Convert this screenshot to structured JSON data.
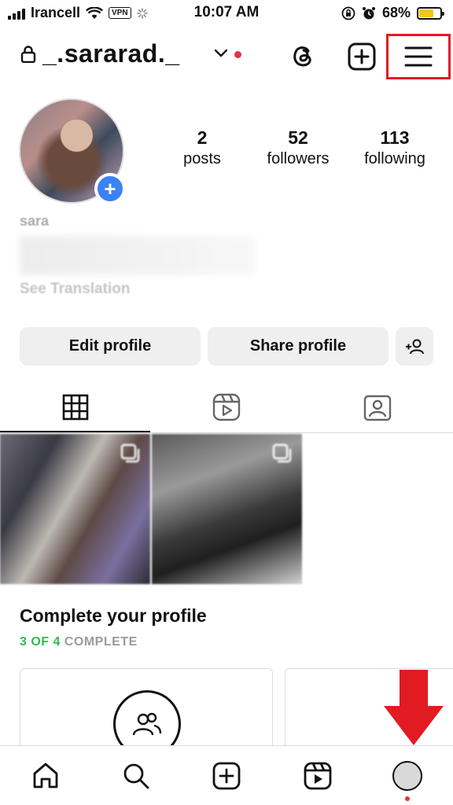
{
  "status_bar": {
    "carrier": "Irancell",
    "vpn": "VPN",
    "time": "10:07 AM",
    "battery": "68%",
    "battery_level": 0.68,
    "battery_color": "#f5c518"
  },
  "header": {
    "username": "_.sararad._",
    "icons": [
      "lock-icon",
      "chevron-down-icon",
      "threads-icon",
      "create-icon",
      "menu-icon"
    ]
  },
  "profile": {
    "stats": [
      {
        "value": "2",
        "label": "posts"
      },
      {
        "value": "52",
        "label": "followers"
      },
      {
        "value": "113",
        "label": "following"
      }
    ],
    "name": "sara",
    "see_translation": "See Translation",
    "add_story": "+"
  },
  "buttons": {
    "edit": "Edit profile",
    "share": "Share profile"
  },
  "tabs": [
    "grid-icon",
    "reels-icon",
    "tagged-icon"
  ],
  "complete": {
    "title": "Complete your profile",
    "progress": "3 OF 4",
    "progress_suffix": " COMPLETE"
  },
  "bottom_nav": [
    "home-icon",
    "search-icon",
    "create-icon",
    "reels-icon",
    "profile-avatar"
  ],
  "colors": {
    "accent_blue": "#3b82f6",
    "notification_red": "#e8303a",
    "highlight_red": "#e21b23",
    "progress_green": "#2fbd4e"
  }
}
